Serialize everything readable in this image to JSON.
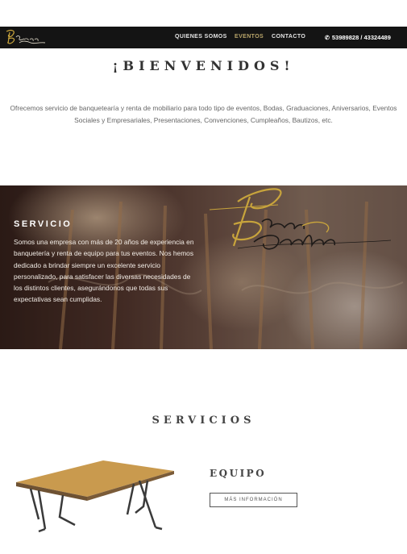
{
  "nav": {
    "logo_alt": "Bravo Catalán",
    "links": [
      "QUIENES SOMOS",
      "EVENTOS",
      "CONTACTO"
    ],
    "active_index": 1,
    "phone_icon": "phone-icon",
    "phone": "53989828 / 43324489"
  },
  "welcome": {
    "title": "¡BIENVENIDOS!",
    "text": "Ofrecemos servicio de banquetearía y renta de mobiliario para todo tipo de eventos, Bodas, Graduaciones, Aniversarios, Eventos Sociales y Empresariales, Presentaciones, Convenciones, Cumpleaños, Bautizos, etc."
  },
  "hero": {
    "heading": "SERVICIO",
    "body": "Somos una empresa con más de 20 años de experiencia en banquetería y renta de equipo para tus eventos. Nos hemos dedicado a brindar siempre un excelente servicio personalizado, para satisfacer las diversas necesidades de los distintos clientes, asegurándonos que todas sus expectativas sean cumplidas.",
    "logo_text": "Bravo Catalán"
  },
  "services": {
    "title": "SERVICIOS",
    "items": [
      {
        "title": "EQUIPO",
        "button": "MÁS INFORMACIÓN"
      }
    ]
  },
  "colors": {
    "nav_bg": "#141414",
    "gold": "#c8a43c",
    "active_link": "#b9a56a"
  }
}
